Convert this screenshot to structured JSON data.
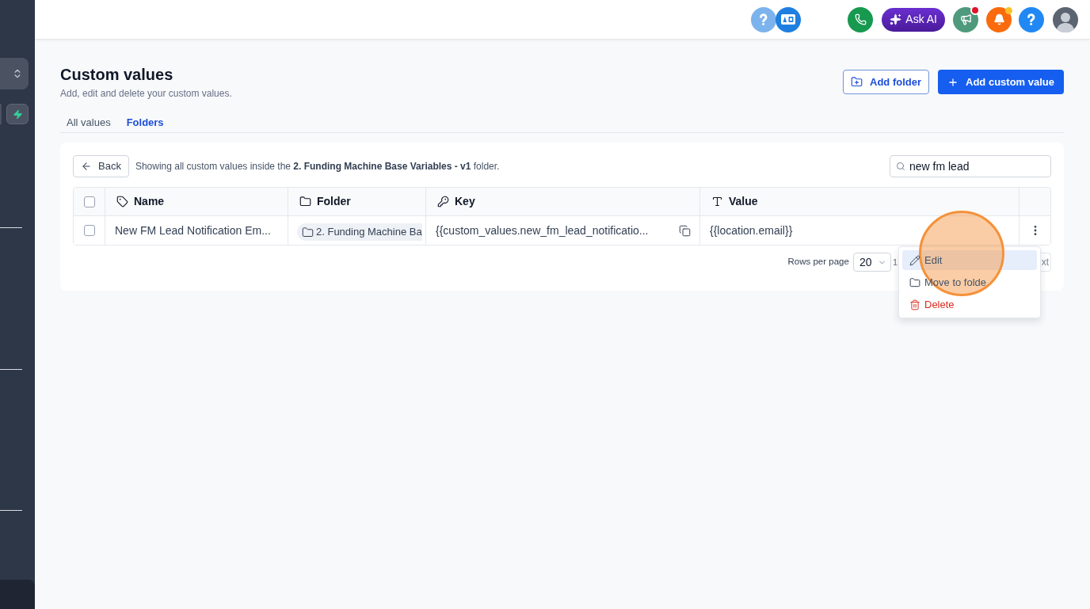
{
  "topbar": {
    "ask_ai": "Ask AI",
    "announcements_unread": true,
    "notifications_unread": true
  },
  "header": {
    "title": "Custom values",
    "subtitle": "Add, edit and delete your custom values.",
    "buttons": [
      {
        "kind": "outline",
        "label": "Add folder"
      },
      {
        "kind": "primary",
        "label": "Add custom value"
      }
    ]
  },
  "tabs": [
    {
      "label": "All values",
      "selected": false
    },
    {
      "label": "Folders",
      "selected": true
    }
  ],
  "folder_view": {
    "back_button": "Back",
    "description": "Showing all custom values inside the **2. Funding Machine Base Variables - v1** folder.",
    "search": {
      "value": "new fm lead"
    }
  },
  "table": {
    "all_selected": false,
    "columns": [
      "Name",
      "Folder",
      "Key",
      "Value"
    ],
    "rows": [
      {
        "selected": false,
        "name": "New FM Lead Notification Em...",
        "folder": "2. Funding Machine Ba",
        "key": "{{custom_values.new_fm_lead_notificatio...",
        "value": "{{location.email}}"
      }
    ]
  },
  "pagination": {
    "rows_per_page_label": "Rows per page",
    "rows_per_page": "20",
    "page_info": "1",
    "next": {
      "label": "xt",
      "disabled": true
    }
  },
  "row_menu": {
    "items": [
      {
        "kind": "edit",
        "label": "Edit",
        "highlighted": true
      },
      {
        "kind": "move",
        "label": "Move to folde",
        "highlighted": false
      },
      {
        "kind": "delete",
        "label": "Delete",
        "highlighted": false
      }
    ]
  }
}
